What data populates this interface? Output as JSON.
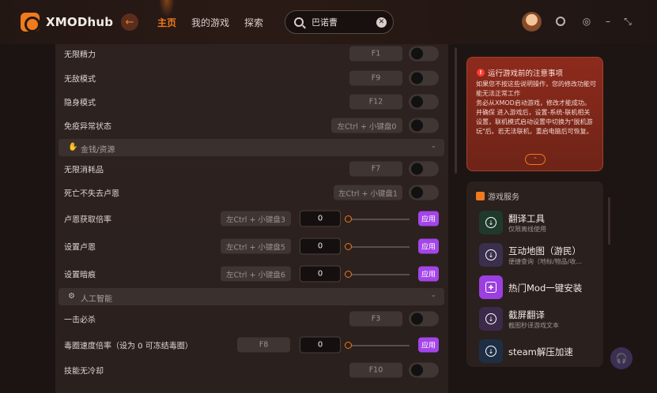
{
  "app": {
    "title": "XMODhub"
  },
  "nav": {
    "tabs": [
      {
        "label": "主页"
      },
      {
        "label": "我的游戏"
      },
      {
        "label": "探索"
      }
    ]
  },
  "search": {
    "value": "巴诺曹"
  },
  "colors": {
    "accent": "#f07a1c",
    "apply": "#a445e8",
    "notice": "#8d2a1d"
  },
  "rows": [
    {
      "label": "无限精力",
      "key": "F1"
    },
    {
      "label": "无敌模式",
      "key": "F9"
    },
    {
      "label": "隐身模式",
      "key": "F12"
    },
    {
      "label": "免疫异常状态",
      "key": "左Ctrl + 小键盘0"
    },
    {
      "label": "无限消耗品",
      "key": "F7"
    },
    {
      "label": "死亡不失去卢恩",
      "key": "左Ctrl + 小键盘1"
    },
    {
      "label": "卢恩获取倍率",
      "key": "左Ctrl + 小键盘3",
      "value": "0",
      "apply": "应用"
    },
    {
      "label": "设置卢恩",
      "key": "左Ctrl + 小键盘5",
      "value": "0",
      "apply": "应用"
    },
    {
      "label": "设置暗痕",
      "key": "左Ctrl + 小键盘6",
      "value": "0",
      "apply": "应用"
    },
    {
      "label": "一击必杀",
      "key": "F3"
    },
    {
      "label": "毒圈速度倍率（设为 0 可冻结毒圈）",
      "key": "F8",
      "value": "0",
      "apply": "应用"
    },
    {
      "label": "技能无冷却",
      "key": "F10"
    }
  ],
  "sections": [
    {
      "label": "金钱/资源"
    },
    {
      "label": "人工智能"
    }
  ],
  "notice": {
    "title": "运行游戏前的注意事项",
    "body": "如果您不按这些说明操作，您的修改功能可能无法正常工作\n务必从XMOD启动游戏，修改才能成功。\n并确保 进入游戏后，设置-系统-联机相关设置，联机模式启动设置中切换为\"脱机游玩\"后。若无法联机，重启电脑后可恢复。"
  },
  "services": {
    "header": "游戏服务",
    "items": [
      {
        "title": "翻译工具",
        "sub": "仅限离线使用",
        "color": "#1f3a2c"
      },
      {
        "title": "互动地图（游民）",
        "sub": "便捷查询（地标/物品/收...",
        "color": "#3a2f4d"
      },
      {
        "title": "热门Mod一键安装",
        "sub": "",
        "color": "#9b3fe0"
      },
      {
        "title": "截屏翻译",
        "sub": "截图秒译游戏文本",
        "color": "#3d2a4a"
      },
      {
        "title": "steam解压加速",
        "sub": "",
        "color": "#1e2f45"
      }
    ]
  }
}
